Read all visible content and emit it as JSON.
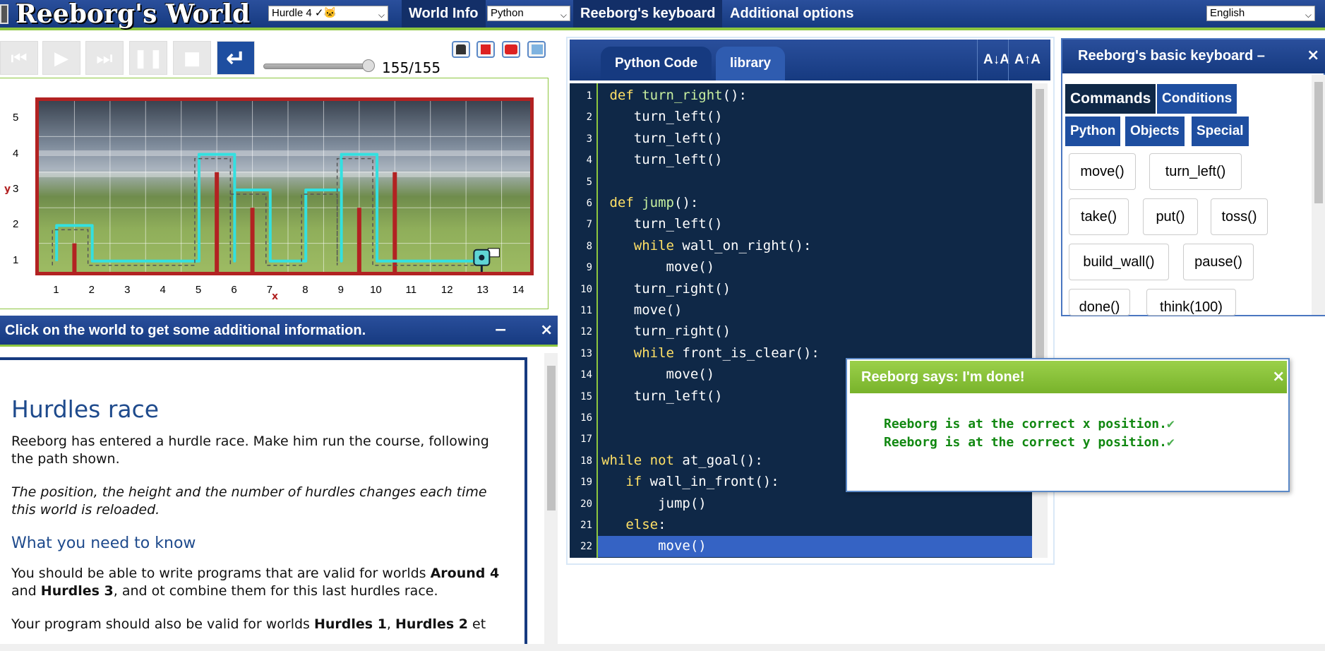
{
  "app": {
    "title": "Reeborg's World"
  },
  "topbar": {
    "world_select": "Hurdle 4 ✓🐱",
    "world_info": "World Info",
    "language_select": "Python",
    "keyboard_btn": "Reeborg's keyboard",
    "options_btn": "Additional options",
    "ui_language": "English"
  },
  "controls": {
    "step": "155/155",
    "progress": 1.0
  },
  "world": {
    "x_ticks": [
      "1",
      "2",
      "3",
      "4",
      "5",
      "6",
      "7",
      "8",
      "9",
      "10",
      "11",
      "12",
      "13",
      "14"
    ],
    "y_ticks": [
      "5",
      "4",
      "3",
      "2",
      "1"
    ],
    "x_name": "x",
    "y_name": "y"
  },
  "info": {
    "header": "Click on the world to get some additional information.",
    "minimize": "−",
    "close": "×",
    "title": "Hurdles race",
    "p1": "Reeborg has entered a hurdle race. Make him run the course, following the path shown.",
    "p2": "The position, the height and the number of hurdles changes each time this world is reloaded.",
    "h2": "What you need to know",
    "p3_a": "You should be able to write programs that are valid for worlds ",
    "p3_b": "Around 4",
    "p3_c": " and ",
    "p3_d": "Hurdles 3",
    "p3_e": ", and ot combine them for this last hurdles race.",
    "p4_a": "Your program should also be valid for worlds ",
    "p4_b": "Hurdles 1",
    "p4_c": ", ",
    "p4_d": "Hurdles 2",
    "p4_e": " et"
  },
  "editor": {
    "tab_code": "Python Code",
    "tab_library": "library",
    "font_down": "A↓A",
    "font_up": "A↑A",
    "lines": [
      {
        "n": "1",
        "kw": "def",
        "sp": " ",
        "fn": "turn_right",
        "rest": "():"
      },
      {
        "n": "2",
        "kw": "",
        "sp": "    ",
        "fn": "",
        "rest": "turn_left()"
      },
      {
        "n": "3",
        "kw": "",
        "sp": "    ",
        "fn": "",
        "rest": "turn_left()"
      },
      {
        "n": "4",
        "kw": "",
        "sp": "    ",
        "fn": "",
        "rest": "turn_left()"
      },
      {
        "n": "5",
        "kw": "",
        "sp": "",
        "fn": "",
        "rest": ""
      },
      {
        "n": "6",
        "kw": "def",
        "sp": " ",
        "fn": "jump",
        "rest": "():"
      },
      {
        "n": "7",
        "kw": "",
        "sp": "    ",
        "fn": "",
        "rest": "turn_left()"
      },
      {
        "n": "8",
        "kw": "while",
        "sp": "    ",
        "fn": "",
        "rest": " wall_on_right():"
      },
      {
        "n": "9",
        "kw": "",
        "sp": "        ",
        "fn": "",
        "rest": "move()"
      },
      {
        "n": "10",
        "kw": "",
        "sp": "    ",
        "fn": "",
        "rest": "turn_right()"
      },
      {
        "n": "11",
        "kw": "",
        "sp": "    ",
        "fn": "",
        "rest": "move()"
      },
      {
        "n": "12",
        "kw": "",
        "sp": "    ",
        "fn": "",
        "rest": "turn_right()"
      },
      {
        "n": "13",
        "kw": "while",
        "sp": "    ",
        "fn": "",
        "rest": " front_is_clear():"
      },
      {
        "n": "14",
        "kw": "",
        "sp": "        ",
        "fn": "",
        "rest": "move()"
      },
      {
        "n": "15",
        "kw": "",
        "sp": "    ",
        "fn": "",
        "rest": "turn_left()"
      },
      {
        "n": "16",
        "kw": "",
        "sp": "",
        "fn": "",
        "rest": ""
      },
      {
        "n": "17",
        "kw": "",
        "sp": "",
        "fn": "",
        "rest": ""
      },
      {
        "n": "18",
        "kw": "while not",
        "sp": "",
        "fn": "",
        "rest": " at_goal():"
      },
      {
        "n": "19",
        "kw": "if",
        "sp": "   ",
        "fn": "",
        "rest": " wall_in_front():"
      },
      {
        "n": "20",
        "kw": "",
        "sp": "       ",
        "fn": "",
        "rest": "jump()"
      },
      {
        "n": "21",
        "kw": "else",
        "sp": "   ",
        "fn": "",
        "rest": ":"
      },
      {
        "n": "22",
        "kw": "",
        "sp": "       ",
        "fn": "",
        "rest": "move()"
      }
    ]
  },
  "keyboard": {
    "title": "Reeborg's basic keyboard –",
    "close": "×",
    "tabs": [
      "Commands",
      "Conditions",
      "Python",
      "Objects",
      "Special"
    ],
    "keys": [
      "move()",
      "turn_left()",
      "take()",
      "put()",
      "toss()",
      "build_wall()",
      "pause()",
      "done()",
      "think(100)"
    ]
  },
  "dialog": {
    "title": "Reeborg says: I'm done!",
    "close": "×",
    "msg1": "Reeborg is at the correct x position.",
    "msg2": "Reeborg is at the correct y position.",
    "check": "✔"
  },
  "colors": {
    "header_blue": "#163a80",
    "accent_green": "#8dc63f",
    "code_bg": "#0f2847",
    "wall_red": "#b22222",
    "path_cyan": "#33e0e0",
    "dialog_green": "#78b32b"
  }
}
